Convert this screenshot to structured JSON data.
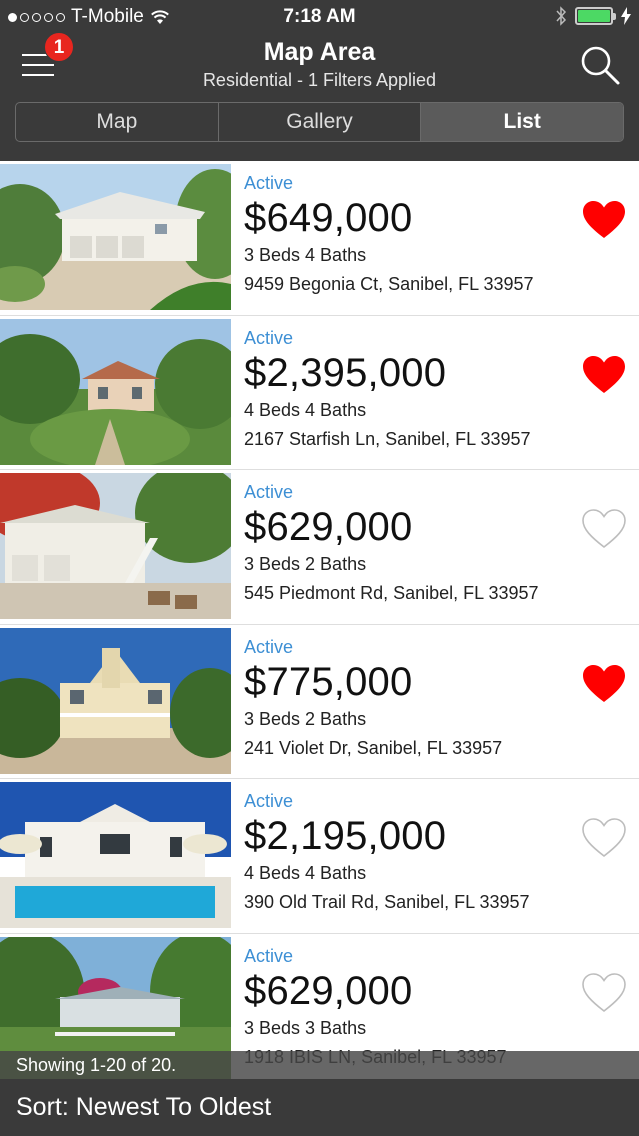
{
  "status_bar": {
    "carrier": "T-Mobile",
    "time": "7:18 AM"
  },
  "header": {
    "title": "Map Area",
    "subtitle": "Residential - 1 Filters Applied",
    "menu_badge": "1",
    "tabs": [
      {
        "label": "Map",
        "active": false
      },
      {
        "label": "Gallery",
        "active": false
      },
      {
        "label": "List",
        "active": true
      }
    ]
  },
  "colors": {
    "header_bg": "#3a3a3a",
    "status_blue": "#3d8fd4",
    "heart_red": "#ff0000",
    "badge_red": "#e8261f"
  },
  "listings": [
    {
      "status": "Active",
      "price": "$649,000",
      "beds_baths": "3 Beds 4 Baths",
      "address": "9459 Begonia Ct, Sanibel, FL 33957",
      "favorited": true
    },
    {
      "status": "Active",
      "price": "$2,395,000",
      "beds_baths": "4 Beds 4 Baths",
      "address": "2167 Starfish Ln, Sanibel, FL 33957",
      "favorited": true
    },
    {
      "status": "Active",
      "price": "$629,000",
      "beds_baths": "3 Beds 2 Baths",
      "address": "545 Piedmont Rd, Sanibel, FL 33957",
      "favorited": false
    },
    {
      "status": "Active",
      "price": "$775,000",
      "beds_baths": "3 Beds 2 Baths",
      "address": "241 Violet Dr, Sanibel, FL 33957",
      "favorited": true
    },
    {
      "status": "Active",
      "price": "$2,195,000",
      "beds_baths": "4 Beds 4 Baths",
      "address": "390 Old Trail Rd, Sanibel, FL 33957",
      "favorited": false
    },
    {
      "status": "Active",
      "price": "$629,000",
      "beds_baths": "3 Beds 3 Baths",
      "address": "1918 IBIS LN, Sanibel, FL 33957",
      "favorited": false
    }
  ],
  "footer": {
    "showing": "Showing 1-20 of 20.",
    "sort": "Sort: Newest To Oldest"
  }
}
